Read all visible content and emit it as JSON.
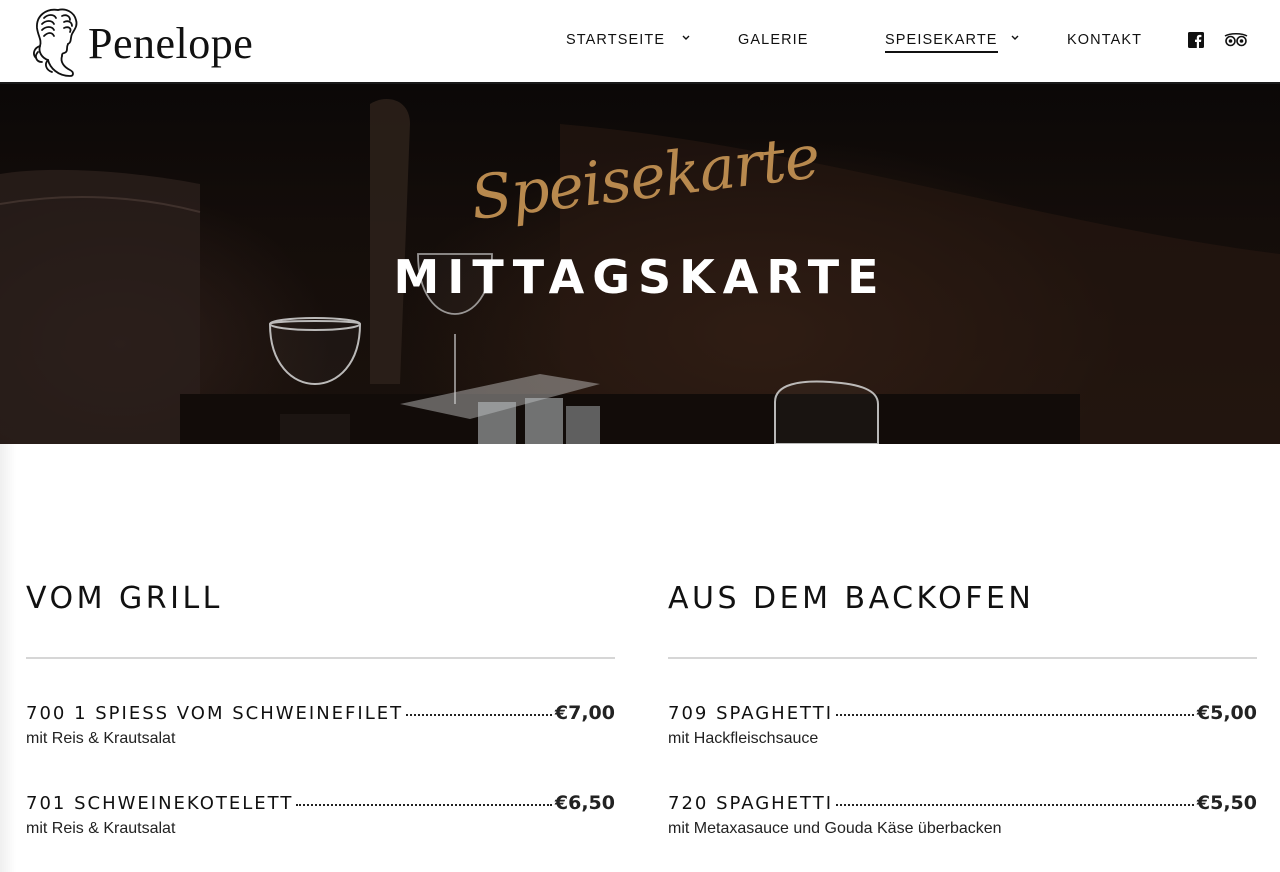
{
  "header": {
    "brand": "Penelope",
    "nav": [
      {
        "label": "STARTSEITE",
        "has_dropdown": true,
        "active": false
      },
      {
        "label": "GALERIE",
        "has_dropdown": false,
        "active": false
      },
      {
        "label": "SPEISEKARTE",
        "has_dropdown": true,
        "active": true
      },
      {
        "label": "KONTAKT",
        "has_dropdown": false,
        "active": false
      }
    ],
    "social": [
      {
        "icon": "facebook-icon"
      },
      {
        "icon": "tripadvisor-icon"
      }
    ]
  },
  "hero": {
    "script_title": "Speisekarte",
    "title": "MITTAGSKARTE"
  },
  "menu": {
    "left": {
      "title": "VOM GRILL",
      "items": [
        {
          "name": "700 1 SPIESS VOM SCHWEINEFILET",
          "price": "€7,00",
          "description": "mit Reis & Krautsalat"
        },
        {
          "name": "701 SCHWEINEKOTELETT",
          "price": "€6,50",
          "description": "mit Reis & Krautsalat"
        }
      ]
    },
    "right": {
      "title": "AUS DEM BACKOFEN",
      "items": [
        {
          "name": "709 SPAGHETTI",
          "price": "€5,00",
          "description": "mit Hackfleischsauce"
        },
        {
          "name": "720 SPAGHETTI",
          "price": "€5,50",
          "description": "mit Metaxasauce und Gouda Käse überbacken"
        }
      ]
    }
  },
  "colors": {
    "accent_gold": "#b8894e",
    "text": "#111111",
    "rule": "#d6d6d6"
  }
}
